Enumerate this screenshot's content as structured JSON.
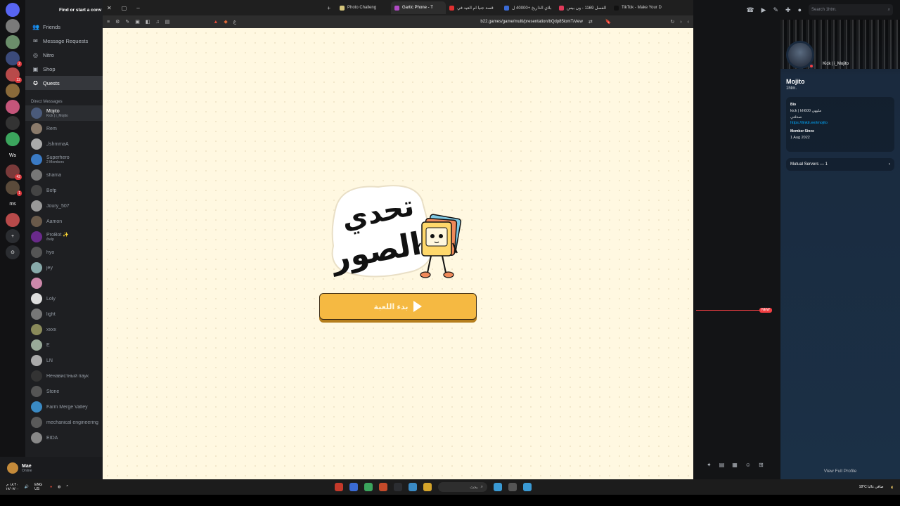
{
  "rail": {
    "servers": [
      {
        "color": "#5865f2",
        "label": "",
        "badge": ""
      },
      {
        "color": "#7a7a7a",
        "label": "",
        "badge": ""
      },
      {
        "color": "#6b8e6b",
        "label": "",
        "badge": ""
      },
      {
        "color": "#3b4a7a",
        "label": "",
        "badge": "2"
      },
      {
        "color": "#b84a4a",
        "label": "",
        "badge": "22"
      },
      {
        "color": "#8a6a3a",
        "label": "",
        "badge": ""
      },
      {
        "color": "#c4557a",
        "label": "",
        "badge": ""
      },
      {
        "color": "#333",
        "label": "",
        "badge": ""
      },
      {
        "color": "#3ba55d",
        "label": "",
        "badge": ""
      },
      {
        "color": "#121214",
        "label": "Ws",
        "badge": ""
      },
      {
        "color": "#7a3a3a",
        "label": "",
        "badge": "42"
      },
      {
        "color": "#5a4a3a",
        "label": "",
        "badge": "1"
      },
      {
        "color": "#121214",
        "label": "ms",
        "badge": ""
      },
      {
        "color": "#b84a4a",
        "label": "",
        "badge": ""
      },
      {
        "color": "#2b2d31",
        "label": "+",
        "badge": ""
      },
      {
        "color": "#2b2d31",
        "label": "⊙",
        "badge": ""
      }
    ]
  },
  "sidebar": {
    "find_label": "Find or start a conv",
    "nav": [
      {
        "label": "Friends",
        "icon": "👥"
      },
      {
        "label": "Message Requests",
        "icon": "✉"
      },
      {
        "label": "Nitro",
        "icon": "◎"
      },
      {
        "label": "Shop",
        "icon": "▣"
      },
      {
        "label": "Quests",
        "icon": "✪"
      }
    ],
    "dm_header": "Direct Messages",
    "dms": [
      {
        "name": "Mojito",
        "sub": "Kick | i_Mojito",
        "color": "#4a5a7a"
      },
      {
        "name": "Rem",
        "sub": "",
        "color": "#8a7a6a"
      },
      {
        "name": "ـ/shmmaA",
        "sub": "",
        "color": "#aaa"
      },
      {
        "name": "Superhero",
        "sub": "2 Members",
        "color": "#3a7ac4"
      },
      {
        "name": "shama",
        "sub": "",
        "color": "#777"
      },
      {
        "name": "Bofp",
        "sub": "",
        "color": "#444"
      },
      {
        "name": "Joury_507",
        "sub": "",
        "color": "#999"
      },
      {
        "name": "Aamon",
        "sub": "",
        "color": "#6a5a4a"
      },
      {
        "name": "ProBot ✨",
        "sub": "/help",
        "color": "#6a2a8a"
      },
      {
        "name": "hyo",
        "sub": "",
        "color": "#555"
      },
      {
        "name": "jey",
        "sub": "",
        "color": "#8aa"
      },
      {
        "name": "",
        "sub": "",
        "color": "#c8a"
      },
      {
        "name": "Loly",
        "sub": "",
        "color": "#ddd"
      },
      {
        "name": "light",
        "sub": "",
        "color": "#777"
      },
      {
        "name": "xxxx",
        "sub": "",
        "color": "#8a8a5a"
      },
      {
        "name": "E",
        "sub": "",
        "color": "#9a9"
      },
      {
        "name": "LN",
        "sub": "",
        "color": "#aaa"
      },
      {
        "name": "Ненавистный паук",
        "sub": "",
        "color": "#333"
      },
      {
        "name": "Stone",
        "sub": "",
        "color": "#555"
      },
      {
        "name": "Farm Merge Valley",
        "sub": "",
        "color": "#3a8ac4"
      },
      {
        "name": "mechanical engineering",
        "sub": "",
        "color": "#5a5a5a"
      },
      {
        "name": "EIDA",
        "sub": "",
        "color": "#888"
      }
    ],
    "user": {
      "name": "Mae",
      "status": "Online"
    }
  },
  "browser": {
    "tabs": [
      {
        "label": "Photo Challeng",
        "fav": "#d4c47a",
        "active": false
      },
      {
        "label": "Gartic Phone - T",
        "fav": "#b04ac4",
        "active": true
      },
      {
        "label": "قصة جنيا ام العيد في",
        "fav": "#e03030",
        "active": false
      },
      {
        "label": "بلاي الذاريخ +40000 ل",
        "fav": "#3a6ad4",
        "active": false
      },
      {
        "label": "الفصل 1169 - ون بيس",
        "fav": "#e03a5a",
        "active": false
      },
      {
        "label": "TikTok - Make Your D",
        "fav": "#111",
        "active": false
      }
    ],
    "url": "b22.games/game/multi/presentation/bQdp85iomT/view"
  },
  "game": {
    "logo_text_line1": "تحدي",
    "logo_text_line2": "الصور",
    "play_label": "بدء اللعبة"
  },
  "discord": {
    "search_placeholder": "Search 1htm.",
    "new_label": "NEW"
  },
  "profile": {
    "kick": "Kick | i_Mojito",
    "name": "Mojito",
    "handle": "1htm.",
    "bio_heading": "Bio",
    "bio_line1": "kick | kh600 مليهي",
    "bio_line2": "صدقتي",
    "bio_link": "https://linktr.ee/imojito",
    "member_since_heading": "Member Since",
    "member_since": "1 Aug 2022",
    "mutual": "Mutual Servers — 1",
    "view_full": "View Full Profile"
  },
  "taskbar": {
    "time": "١٨:٣٠ م",
    "date": "١٧/٠٧/٠٠",
    "lang": "ENG US",
    "search_label": "بحث",
    "weather": "18°C صافي غالبا",
    "apps": [
      "#c4392a",
      "#3a6ad4",
      "#3ba55d",
      "#c44a2a",
      "#2b2d31",
      "#3a8ac4",
      "#d4a42a",
      "#3a9ad4",
      "#555"
    ]
  }
}
